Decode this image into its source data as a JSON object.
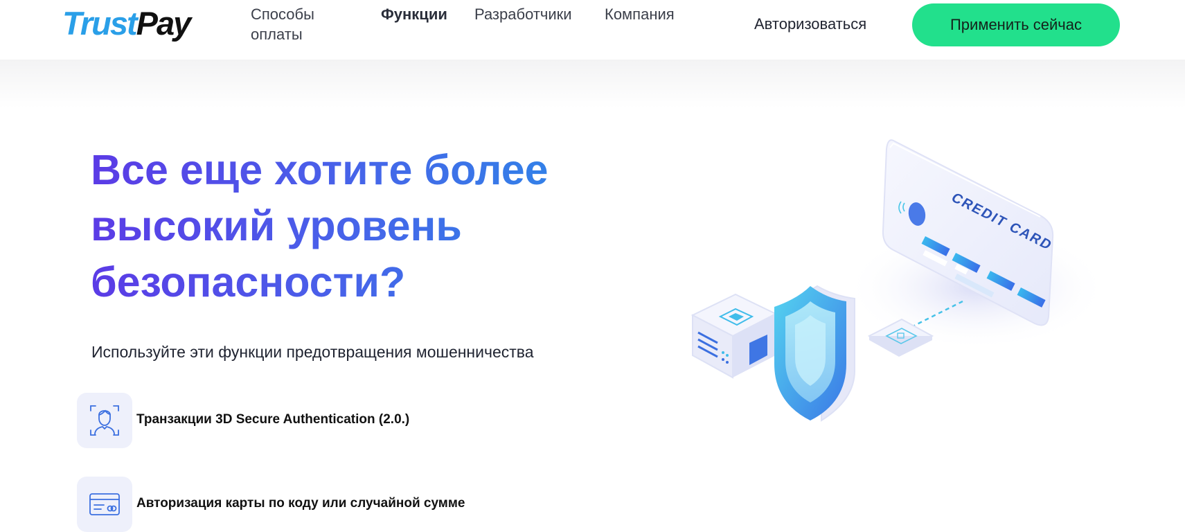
{
  "header": {
    "logo": {
      "part1": "Trust",
      "part2": "Pay"
    },
    "nav": [
      {
        "label_line1": "Способы",
        "label_line2": "оплаты"
      },
      {
        "label": "Функции",
        "active": true
      },
      {
        "label": "Разработчики"
      },
      {
        "label": "Компания"
      }
    ],
    "login_label": "Авторизоваться",
    "apply_label": "Применить сейчас"
  },
  "hero": {
    "headline_lines": [
      "Все еще хотите более",
      "высокий уровень",
      "безопасности?"
    ],
    "subtitle": "Используйте эти функции предотвращения мошенничества",
    "features": [
      {
        "icon": "face-scan-icon",
        "label": "Транзакции 3D Secure Authentication (2.0.)"
      },
      {
        "icon": "card-icon",
        "label": "Авторизация карты по коду или случайной сумме"
      }
    ],
    "illustration": {
      "card_text": "CREDIT CARD",
      "icon": "security-shield-illustration"
    }
  },
  "colors": {
    "brand_blue": "#2a9fe8",
    "accent_green": "#22e08c",
    "headline_purple": "#5b3be6",
    "headline_blue": "#2f86e8"
  }
}
